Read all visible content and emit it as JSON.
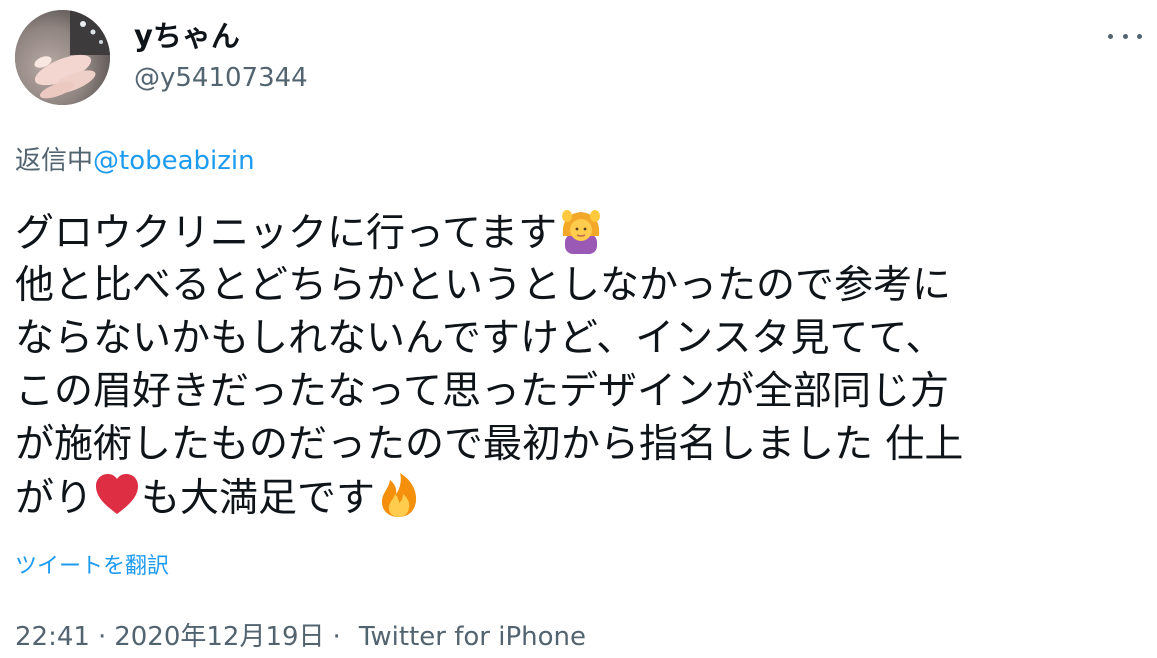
{
  "user": {
    "display_name": "yちゃん",
    "handle": "@y54107344"
  },
  "reply": {
    "prefix": "返信中",
    "mention": "@tobeabizin"
  },
  "tweet": {
    "lines": [
      "グロウクリニックに行ってます",
      "他と比べるとどちらかというとしなかったので参考に",
      "ならないかもしれないんですけど、インスタ見てて、",
      "この眉好きだったなって思ったデザインが全部同じ方",
      "が施術したものだったので最初から指名しました 仕上",
      "がり",
      "も大満足です"
    ],
    "emojis": [
      "person-gesturing-ok-icon",
      "red-heart-icon",
      "fire-icon"
    ]
  },
  "translate_label": "ツイートを翻訳",
  "meta": {
    "time": "22:41",
    "separator": "·",
    "date": "2020年12月19日",
    "source": "Twitter for iPhone"
  },
  "colors": {
    "text": "#0f1419",
    "secondary": "#536471",
    "link": "#1d9bf0"
  }
}
